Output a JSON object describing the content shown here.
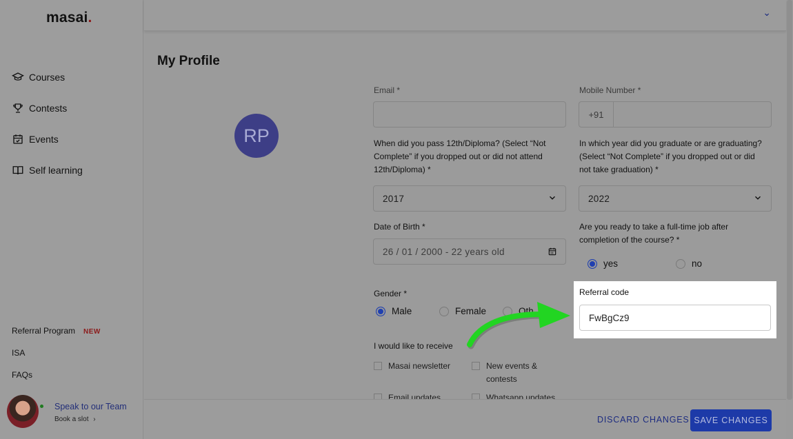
{
  "brand": {
    "name": "masai",
    "dot": "."
  },
  "sidebar": {
    "items": [
      {
        "label": "Courses",
        "icon": "graduation-cap-icon"
      },
      {
        "label": "Contests",
        "icon": "trophy-icon"
      },
      {
        "label": "Events",
        "icon": "calendar-check-icon"
      },
      {
        "label": "Self learning",
        "icon": "book-icon"
      }
    ],
    "bottom_links": [
      {
        "label": "Referral Program",
        "badge": "NEW"
      },
      {
        "label": "ISA"
      },
      {
        "label": "FAQs"
      }
    ],
    "speak": {
      "title": "Speak to our Team",
      "subtitle": "Book a slot",
      "chevron": "›"
    }
  },
  "topbar": {
    "chevron": "⌄"
  },
  "page": {
    "title": "My Profile",
    "avatar_initials": "RP"
  },
  "form": {
    "email": {
      "label": "Email *",
      "value": ""
    },
    "mobile": {
      "label": "Mobile Number *",
      "prefix": "+91",
      "value": ""
    },
    "pass12": {
      "label_lines": [
        "When did you pass 12th/Diploma? (Select “Not",
        "Complete” if you dropped out or did not attend",
        "12th/Diploma) *"
      ],
      "value": "2017"
    },
    "graduation": {
      "label_lines": [
        "In which year did you graduate or are graduating?",
        "(Select “Not Complete” if you dropped out or did",
        "not take graduation) *"
      ],
      "value": "2022"
    },
    "dob": {
      "label": "Date of Birth *",
      "value": "26 / 01 / 2000 - 22 years old"
    },
    "job_ready": {
      "label_lines": [
        "Are you ready to take a full-time job after",
        "completion of the course? *"
      ],
      "options": [
        "yes",
        "no"
      ],
      "selected": "yes"
    },
    "gender": {
      "label": "Gender *",
      "options": [
        "Male",
        "Female",
        "Oth"
      ],
      "selected": "Male"
    },
    "referral": {
      "label": "Referral code",
      "value": "FwBgCz9"
    },
    "receive": {
      "label": "I would like to receive",
      "options": [
        "Masai newsletter",
        "New events &",
        "contests",
        "Email updates",
        "Whatsapp updates"
      ]
    }
  },
  "footer": {
    "discard": "DISCARD CHANGES",
    "save": "SAVE CHANGES"
  },
  "colors": {
    "accent": "#1d3aa8",
    "arrow": "#1fcf1f",
    "brand_dot": "#8b1a1a"
  }
}
